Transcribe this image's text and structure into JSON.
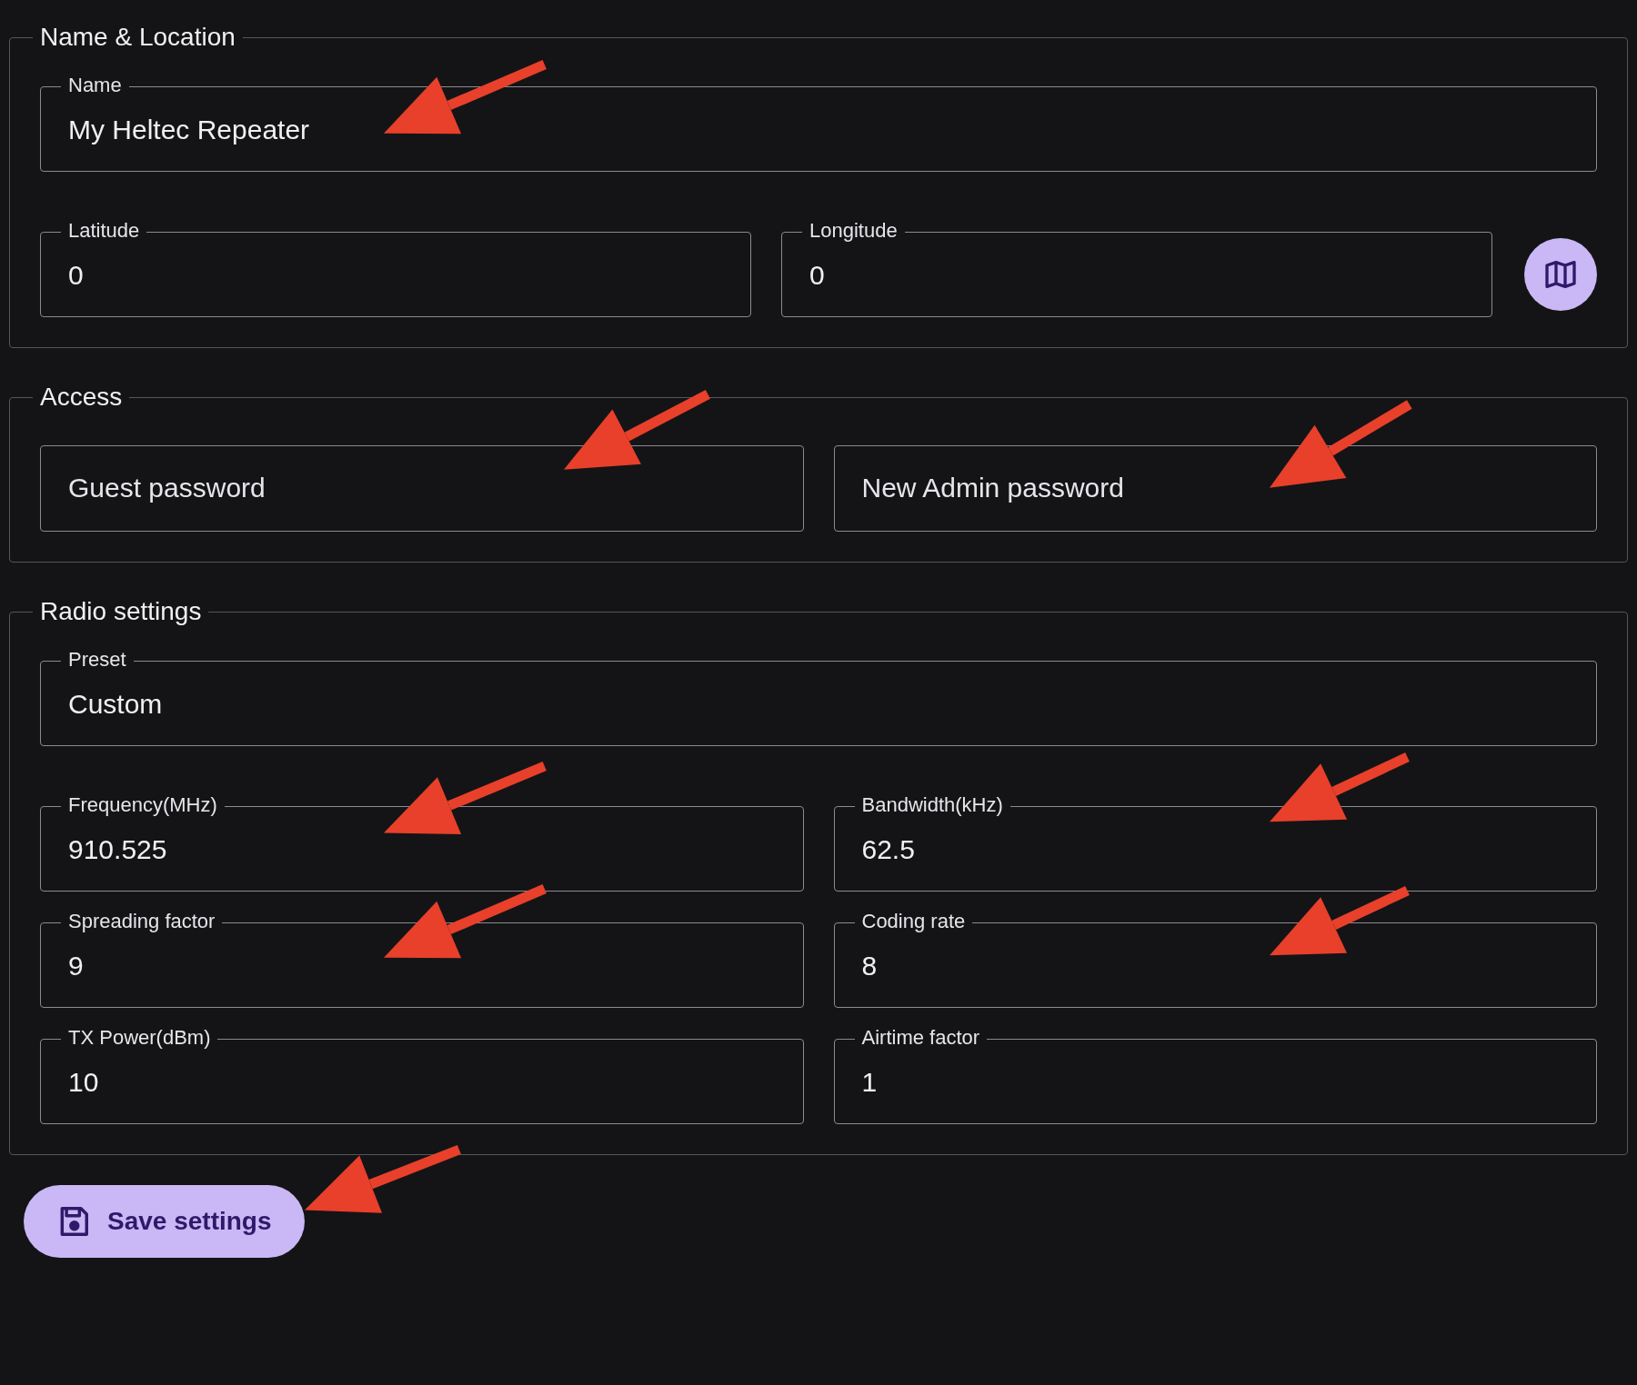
{
  "sections": [
    {
      "title": "Name & Location",
      "rows": [
        [
          {
            "label": "Name",
            "value": "My Heltec Repeater"
          }
        ],
        [
          {
            "label": "Latitude",
            "value": "0"
          },
          {
            "label": "Longitude",
            "value": "0"
          },
          {
            "kind": "map_button"
          }
        ]
      ]
    },
    {
      "title": "Access",
      "rows": [
        [
          {
            "placeholder": "Guest password"
          },
          {
            "placeholder": "New Admin password"
          }
        ]
      ]
    },
    {
      "title": "Radio settings",
      "rows": [
        [
          {
            "label": "Preset",
            "value": "Custom"
          }
        ],
        [
          {
            "label": "Frequency(MHz)",
            "value": "910.525"
          },
          {
            "label": "Bandwidth(kHz)",
            "value": "62.5"
          }
        ],
        [
          {
            "label": "Spreading factor",
            "value": "9"
          },
          {
            "label": "Coding rate",
            "value": "8"
          }
        ],
        [
          {
            "label": "TX Power(dBm)",
            "value": "10"
          },
          {
            "label": "Airtime factor",
            "value": "1"
          }
        ]
      ]
    }
  ],
  "save_button": {
    "label": "Save settings"
  }
}
